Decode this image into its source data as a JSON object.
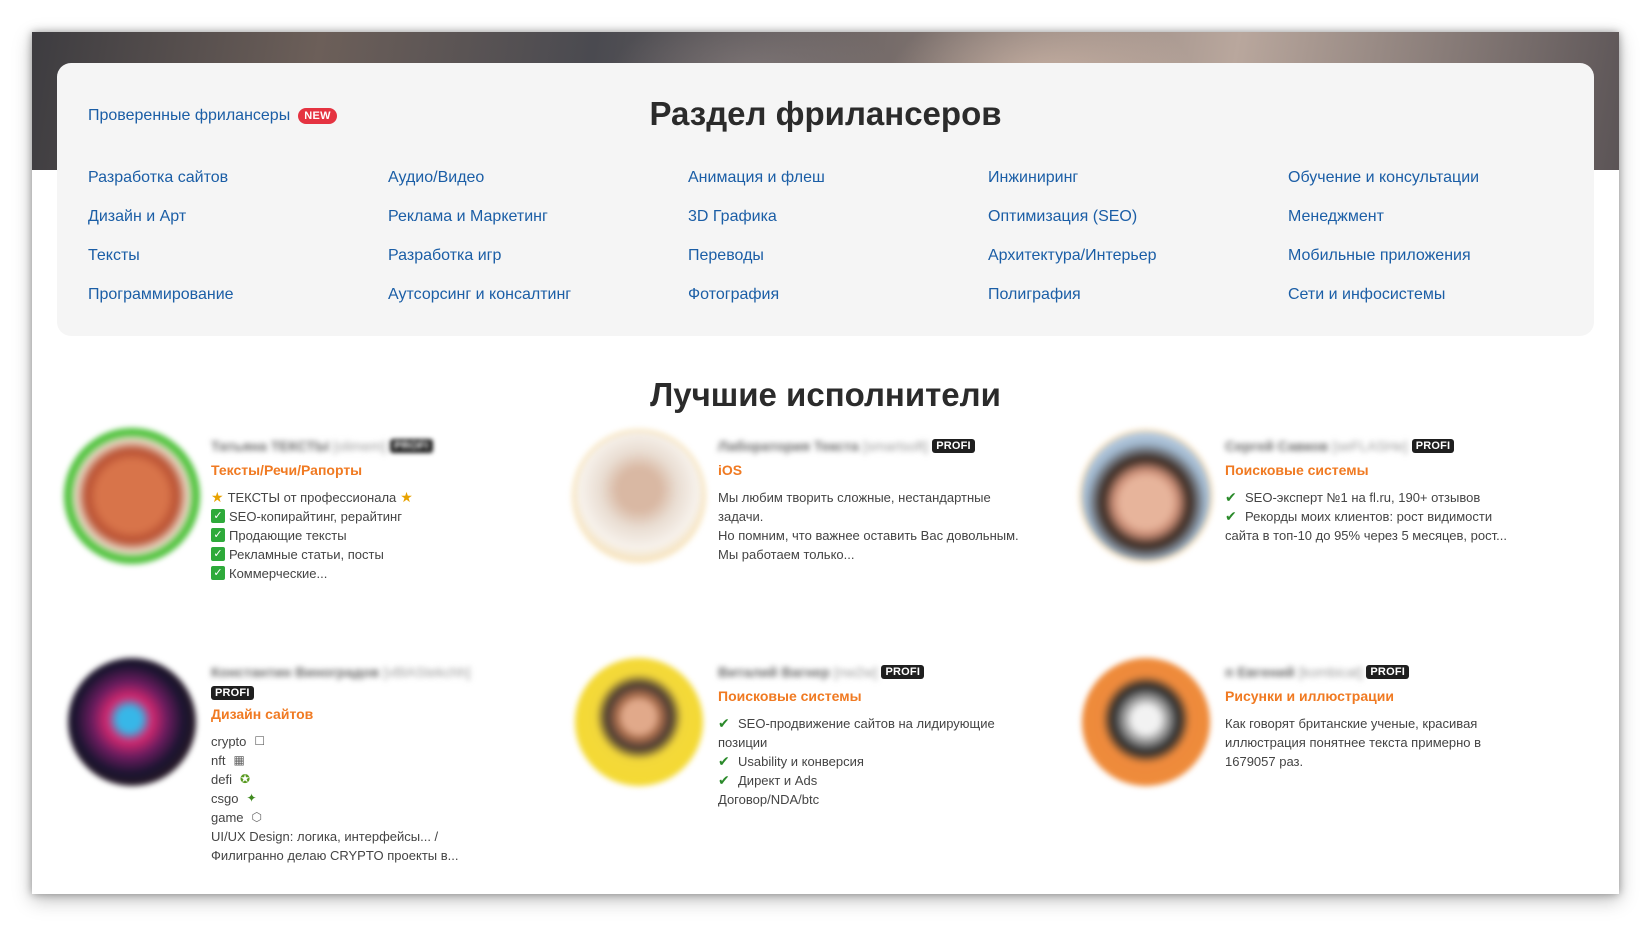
{
  "verified": {
    "label": "Проверенные фрилансеры",
    "badge": "NEW"
  },
  "freelancers_section": {
    "title": "Раздел фрилансеров"
  },
  "categories": [
    "Разработка сайтов",
    "Аудио/Видео",
    "Анимация и флеш",
    "Инжиниринг",
    "Обучение и консультации",
    "Дизайн и Арт",
    "Реклама и Маркетинг",
    "3D Графика",
    "Оптимизация (SEO)",
    "Менеджмент",
    "Тексты",
    "Разработка игр",
    "Переводы",
    "Архитектура/Интерьер",
    "Мобильные приложения",
    "Программирование",
    "Аутсорсинг и консалтинг",
    "Фотография",
    "Полиграфия",
    "Сети и инфосистемы"
  ],
  "best": {
    "title": "Лучшие исполнители"
  },
  "performers": [
    {
      "name": "Татьяна ТЕКСТЫ",
      "login": "[olimem]",
      "badge": "PROFI",
      "specialty": "Тексты/Речи/Рапорты",
      "lines": [
        "ТЕКСТЫ от профессионала",
        "SEO-копирайтинг, рерайтинг",
        "Продающие тексты",
        "Рекламные статьи, посты",
        "Коммерческие..."
      ]
    },
    {
      "name": "Лаборатория Текста",
      "login": "[smartsoft]",
      "badge": "PROFI",
      "specialty": "iOS",
      "lines": [
        "Мы любим творить сложные, нестандартные",
        "задачи.",
        "Но помним, что важнее оставить Вас довольным.",
        "Мы работаем только..."
      ]
    },
    {
      "name": "Сергей Савков",
      "login": "[seFLASHe]",
      "badge": "PROFI",
      "specialty": "Поисковые системы",
      "lines": [
        "SEO-эксперт №1 на fl.ru, 190+ отзывов",
        "Рекорды моих клиентов: рост видимости",
        "сайта в топ-10 до 95% через 5 месяцев, рост..."
      ]
    },
    {
      "name": "Константин Виноградов",
      "login": "[vBlAStekchh]",
      "badge": "PROFI",
      "specialty": "Дизайн сайтов",
      "lines": [
        "crypto",
        "nft",
        "defi",
        "csgo",
        "game",
        "UI/UX Design: логика, интерфейсы... /",
        "Филигранно делаю CRYPTO проекты в..."
      ]
    },
    {
      "name": "Виталий Вагнер",
      "login": "[nw2w]",
      "badge": "PROFI",
      "specialty": "Поисковые системы",
      "lines": [
        "SEO-продвижение сайтов на лидирующие",
        "позиции",
        "Usability и конверсия",
        "Директ и Ads",
        "Договор/NDA/btc"
      ]
    },
    {
      "name": "п Евгений",
      "login": "[kombicat]",
      "badge": "PROFI",
      "specialty": "Рисунки и иллюстрации",
      "lines": [
        "Как говорят британские ученые, красивая",
        "иллюстрация понятнее текста примерно в",
        "1679057 раз."
      ]
    }
  ],
  "colors": {
    "link": "#1b5ea6",
    "specialty": "#f07a22",
    "new_badge": "#e53341",
    "profi_bg": "#1f1f1f",
    "check": "#2eaa3a"
  }
}
